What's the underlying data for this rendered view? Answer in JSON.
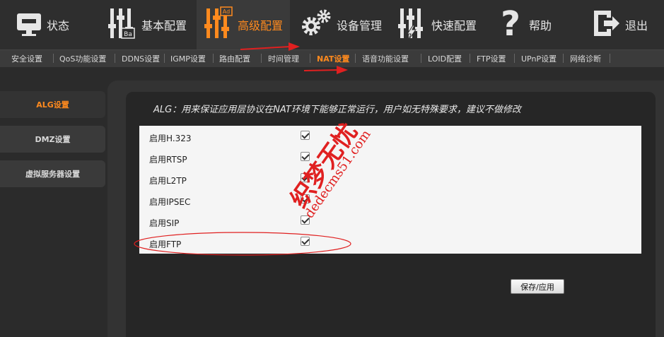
{
  "topnav": {
    "items": [
      {
        "label": "状态",
        "icon": "monitor-icon"
      },
      {
        "label": "基本配置",
        "icon": "sliders-basic-icon",
        "badge": "Ba"
      },
      {
        "label": "高级配置",
        "icon": "sliders-advanced-icon",
        "badge": "Ad"
      },
      {
        "label": "设备管理",
        "icon": "gears-icon"
      },
      {
        "label": "快速配置",
        "icon": "sliders-quick-icon"
      },
      {
        "label": "帮助",
        "icon": "question-icon"
      },
      {
        "label": "退出",
        "icon": "logout-icon"
      }
    ],
    "active_index": 2
  },
  "subnav": {
    "items": [
      "安全设置",
      "QoS功能设置",
      "DDNS设置",
      "IGMP设置",
      "路由配置",
      "时间管理",
      "NAT设置",
      "语音功能设置",
      "LOID配置",
      "FTP设置",
      "UPnP设置",
      "网络诊断"
    ],
    "active_index": 6
  },
  "sidebar": {
    "items": [
      "ALG设置",
      "DMZ设置",
      "虚拟服务器设置"
    ],
    "active_index": 0
  },
  "main": {
    "description": "ALG：用来保证应用层协议在NAT环境下能够正常运行，用户如无特殊要求，建议不做修改",
    "rows": [
      {
        "label": "启用H.323",
        "checked": true
      },
      {
        "label": "启用RTSP",
        "checked": true
      },
      {
        "label": "启用L2TP",
        "checked": true
      },
      {
        "label": "启用IPSEC",
        "checked": true
      },
      {
        "label": "启用SIP",
        "checked": true
      },
      {
        "label": "启用FTP",
        "checked": true
      }
    ],
    "save_label": "保存/应用"
  },
  "watermark": {
    "text1": "织梦无忧",
    "text2": "dedecms51.com"
  },
  "colors": {
    "accent": "#ff8a1e",
    "annotation": "#e02020"
  }
}
